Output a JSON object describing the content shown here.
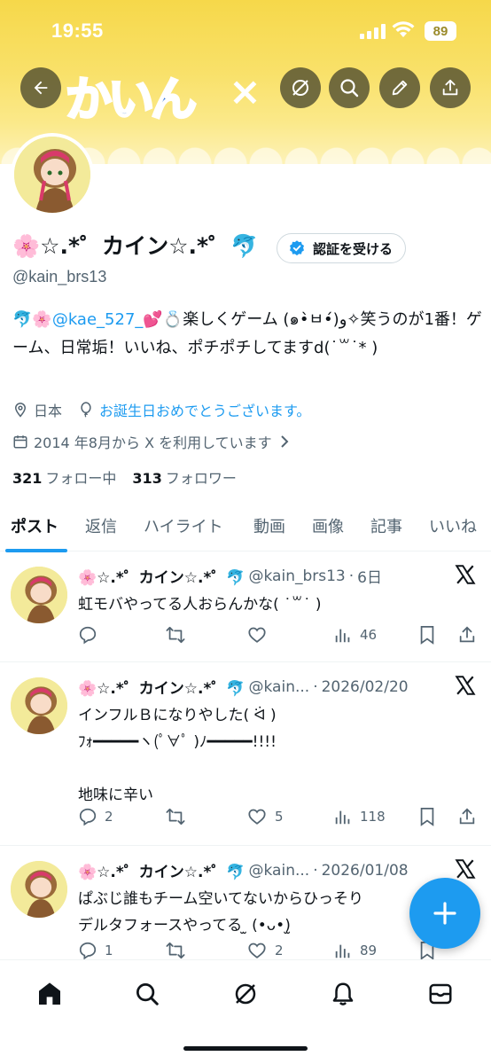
{
  "status_bar": {
    "time": "19:55",
    "battery": "89"
  },
  "banner": {
    "logo_text": "かいん",
    "logo_x": "×"
  },
  "profile": {
    "display_name": "🌸☆.*゜カイン☆.*゜🐬",
    "verify_label": "認証を受ける",
    "handle": "@kain_brs13",
    "bio_prefix": "🐬🌸",
    "bio_mention": "@kae_527_",
    "bio_rest": "💕💍楽しくゲーム (๑•̀ㅂ•́)و✧笑うのが1番！ゲーム、日常垢！いいね、ポチポチしてますd(˙꒳˙* )",
    "location": "日本",
    "birthday_link": "お誕生日おめでとうございます。",
    "joined": "2014 年8月から X を利用しています",
    "following_count": "321",
    "following_label": "フォロー中",
    "followers_count": "313",
    "followers_label": "フォロワー"
  },
  "tabs": [
    "ポスト",
    "返信",
    "ハイライト",
    "動画",
    "画像",
    "記事",
    "いいね"
  ],
  "posts": [
    {
      "name": "🌸☆.*゜カイン☆.*゜🐬",
      "handle": "@kain_brs13",
      "date": "6日",
      "text": "虹モバやってる人おらんかな( ˙꒳˙ )",
      "replies": "",
      "reposts": "",
      "likes": "",
      "views": "46"
    },
    {
      "name": "🌸☆.*゜カイン☆.*゜🐬",
      "handle": "@kain...",
      "date": "2026/02/20",
      "text": "インフルＢになりやした( ᐛ )\nﾌｫ━━━━━ヽ(ﾟ∀ﾟ )ﾉ━━━━━!!!!\n\n地味に辛い",
      "replies": "2",
      "reposts": "",
      "likes": "5",
      "views": "118"
    },
    {
      "name": "🌸☆.*゜カイン☆.*゜🐬",
      "handle": "@kain...",
      "date": "2026/01/08",
      "text": "ぱぶじ誰もチーム空いてないからひっそり\nデルタフォースやってる ̫ (•ᴗ•)̫",
      "replies": "1",
      "reposts": "",
      "likes": "2",
      "views": "89"
    }
  ],
  "icons": {
    "nav": [
      "back-icon",
      "grok-icon",
      "search-icon",
      "edit-icon",
      "share-icon"
    ],
    "bottom": [
      "home-icon",
      "search-icon",
      "grok-icon",
      "notifications-icon",
      "messages-icon"
    ]
  },
  "colors": {
    "accent": "#1d9bf0",
    "text": "#0f1419",
    "muted": "#536471",
    "banner": "#f6d84a"
  }
}
